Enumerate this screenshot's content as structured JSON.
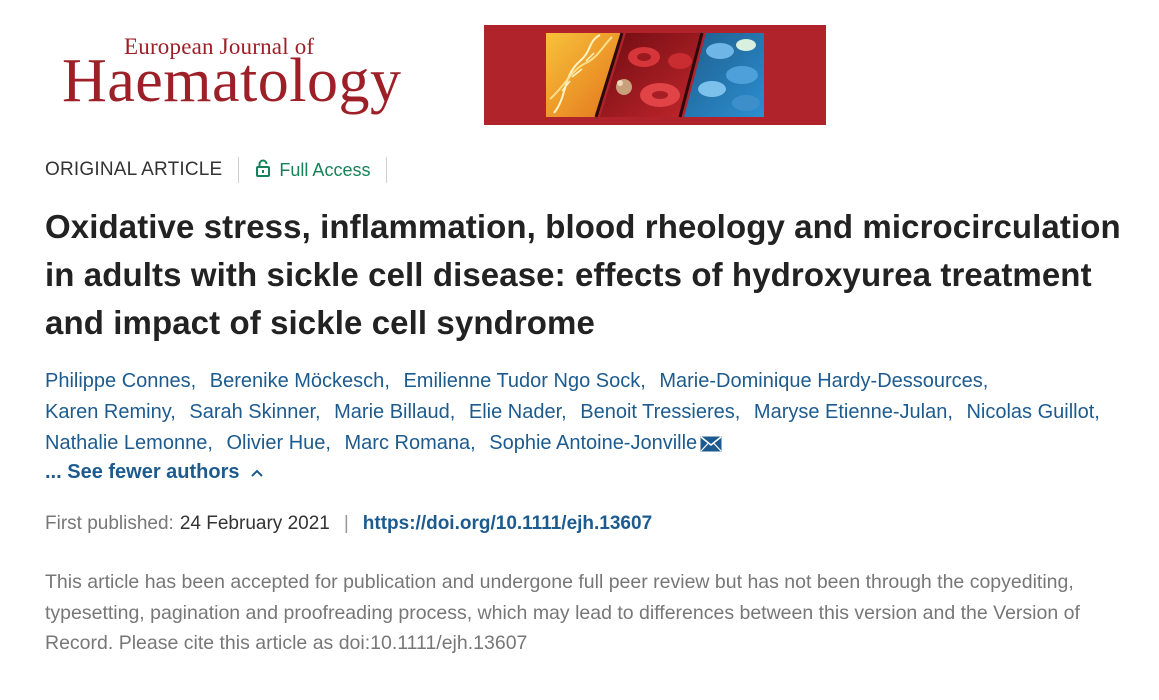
{
  "journal": {
    "name_small": "European Journal of",
    "name_big": "Haematology",
    "brand_color": "#9d1f27",
    "banner_color": "#b1232b"
  },
  "article": {
    "type": "ORIGINAL ARTICLE",
    "access_label": "Full Access",
    "access_icon": "lock-open-icon",
    "access_color": "#17825a",
    "title": "Oxidative stress, inflammation, blood rheology and microcirculation in adults with sickle cell disease: effects of hydroxyurea treatment and impact of sickle cell syndrome"
  },
  "authors": {
    "list": [
      "Philippe Connes",
      "Berenike Möckesch",
      "Emilienne Tudor Ngo Sock",
      "Marie-Dominique Hardy-Dessources",
      "Karen Reminy",
      "Sarah Skinner",
      "Marie Billaud",
      "Elie Nader",
      "Benoit Tressieres",
      "Maryse Etienne-Julan",
      "Nicolas Guillot",
      "Nathalie Lemonne",
      "Olivier Hue",
      "Marc Romana",
      "Sophie Antoine-Jonville"
    ],
    "corresponding_icon": "envelope-icon",
    "toggle_label": "... See fewer authors",
    "link_color": "#1d5b8f"
  },
  "publication": {
    "first_published_label": "First published:",
    "first_published_date": "24 February 2021",
    "separator": "|",
    "doi_url": "https://doi.org/10.1111/ejh.13607"
  },
  "notice": "This article has been accepted for publication and undergone full peer review but has not been through the copyediting, typesetting, pagination and proofreading process, which may lead to differences between this version and the Version of Record. Please cite this article as doi:10.1111/ejh.13607"
}
